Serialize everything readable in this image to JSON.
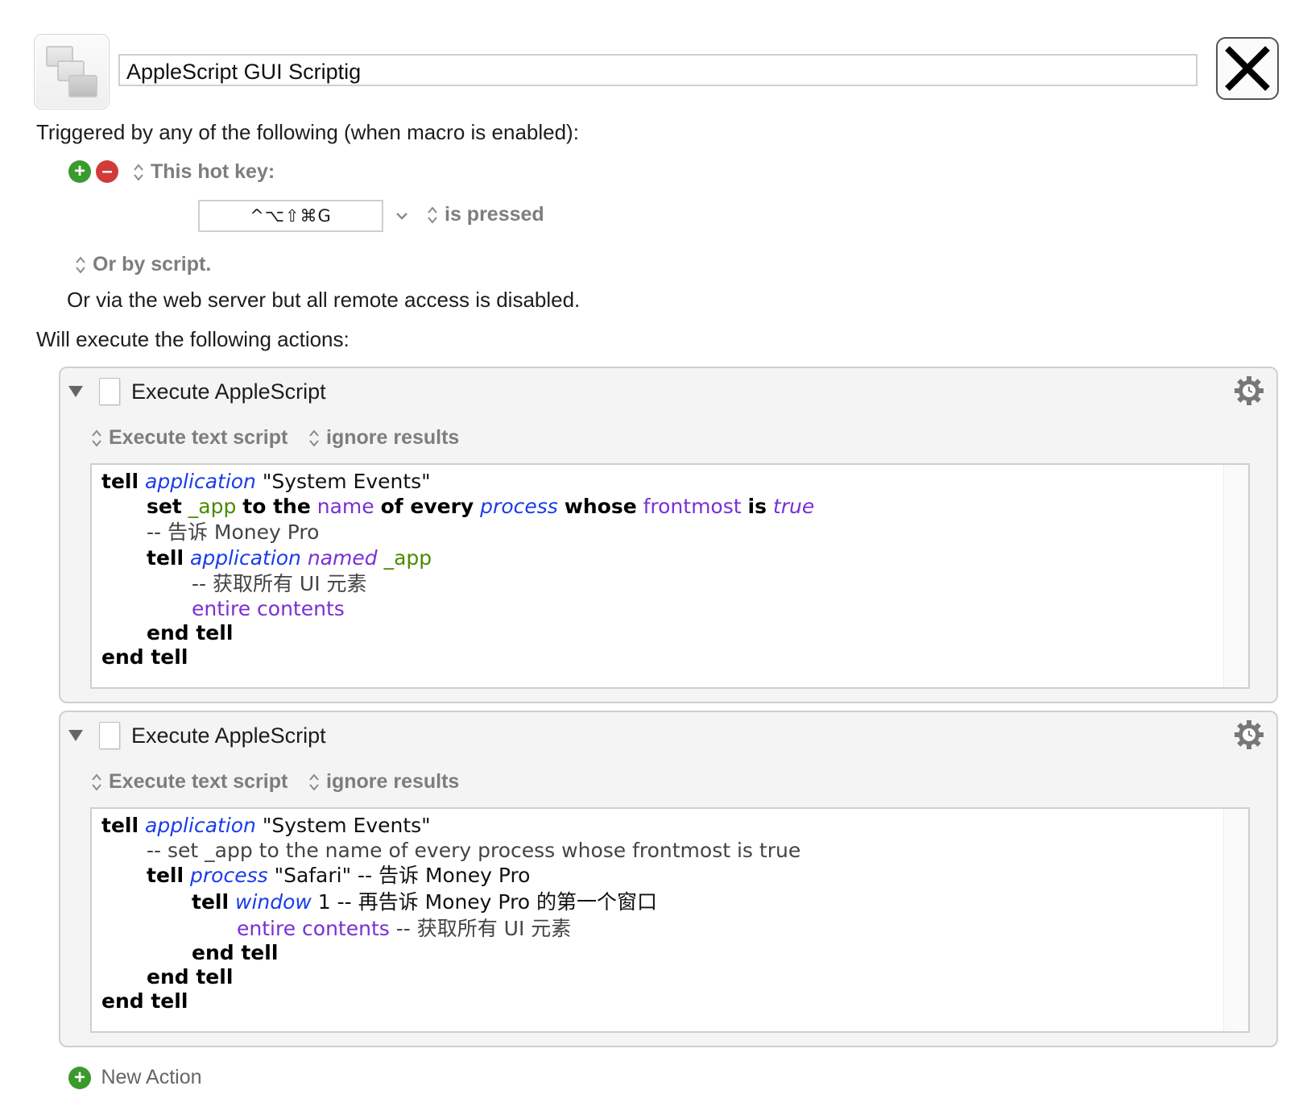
{
  "macro": {
    "name": "AppleScript GUI Scriptig"
  },
  "triggers": {
    "heading": "Triggered by any of the following (when macro is enabled):",
    "hotkey_label": "This hot key:",
    "hotkey_value": "^⌥⇧⌘G",
    "hotkey_condition": "is pressed",
    "script_label": "Or by script.",
    "web_server_text": "Or via the web server but all remote access is disabled."
  },
  "actions_heading": "Will execute the following actions:",
  "actions": [
    {
      "title": "Execute AppleScript",
      "mode": "Execute text script",
      "result": "ignore results",
      "lines": [
        [
          "tell",
          " ",
          "application",
          " \"System Events\""
        ],
        [
          "set",
          " ",
          "_app",
          " ",
          "to the",
          " ",
          "name",
          " ",
          "of every",
          " ",
          "process",
          " ",
          "whose",
          " ",
          "frontmost",
          " ",
          "is",
          " ",
          "true"
        ],
        [
          "-- 告诉 Money Pro"
        ],
        [
          "tell",
          " ",
          "application",
          " ",
          "named",
          " ",
          "_app"
        ],
        [
          "-- 获取所有 UI 元素"
        ],
        [
          "entire contents"
        ],
        [
          "end tell"
        ],
        [
          "end tell"
        ]
      ]
    },
    {
      "title": "Execute AppleScript",
      "mode": "Execute text script",
      "result": "ignore results",
      "lines": [
        [
          "tell",
          " ",
          "application",
          " \"System Events\""
        ],
        [
          "-- set _app to the name of every process whose frontmost is true"
        ],
        [
          "tell",
          " ",
          "process",
          " \"Safari\" -- 告诉 Money Pro"
        ],
        [
          "tell",
          " ",
          "window",
          " 1 -- 再告诉 Money Pro 的第一个窗口"
        ],
        [
          "entire contents",
          " -- 获取所有 UI 元素"
        ],
        [
          "end tell"
        ],
        [
          "end tell"
        ],
        [
          "end tell"
        ]
      ]
    }
  ],
  "new_action_label": "New Action",
  "colors": {
    "keyword": "#000000",
    "class": "#1a3ce8",
    "variable": "#4a8a00",
    "property": "#7a2fd6",
    "comment": "#444444",
    "add_green": "#3a9a2e",
    "remove_red": "#d33a3a"
  },
  "icons": [
    "macro-icon",
    "close-icon",
    "add-icon",
    "remove-icon",
    "updown-icon",
    "chevron-down-icon",
    "disclosure-triangle-icon",
    "script-doc-icon",
    "gear-icon"
  ]
}
